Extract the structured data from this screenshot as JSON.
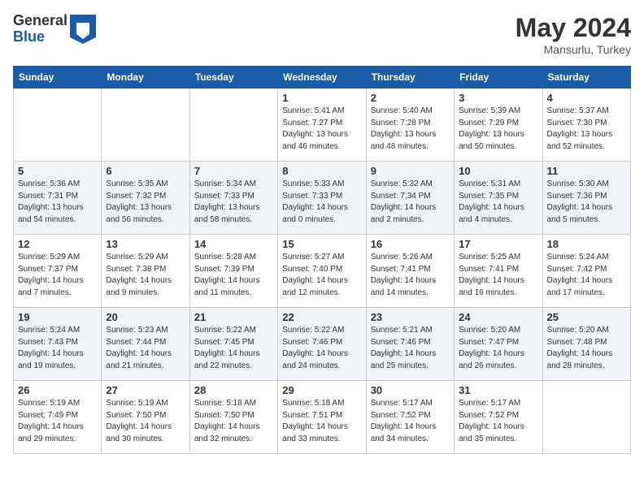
{
  "header": {
    "logo_line1": "General",
    "logo_line2": "Blue",
    "month_year": "May 2024",
    "location": "Mansurlu, Turkey"
  },
  "days_of_week": [
    "Sunday",
    "Monday",
    "Tuesday",
    "Wednesday",
    "Thursday",
    "Friday",
    "Saturday"
  ],
  "weeks": [
    [
      {
        "day": "",
        "info": ""
      },
      {
        "day": "",
        "info": ""
      },
      {
        "day": "",
        "info": ""
      },
      {
        "day": "1",
        "info": "Sunrise: 5:41 AM\nSunset: 7:27 PM\nDaylight: 13 hours\nand 46 minutes."
      },
      {
        "day": "2",
        "info": "Sunrise: 5:40 AM\nSunset: 7:28 PM\nDaylight: 13 hours\nand 48 minutes."
      },
      {
        "day": "3",
        "info": "Sunrise: 5:39 AM\nSunset: 7:29 PM\nDaylight: 13 hours\nand 50 minutes."
      },
      {
        "day": "4",
        "info": "Sunrise: 5:37 AM\nSunset: 7:30 PM\nDaylight: 13 hours\nand 52 minutes."
      }
    ],
    [
      {
        "day": "5",
        "info": "Sunrise: 5:36 AM\nSunset: 7:31 PM\nDaylight: 13 hours\nand 54 minutes."
      },
      {
        "day": "6",
        "info": "Sunrise: 5:35 AM\nSunset: 7:32 PM\nDaylight: 13 hours\nand 56 minutes."
      },
      {
        "day": "7",
        "info": "Sunrise: 5:34 AM\nSunset: 7:33 PM\nDaylight: 13 hours\nand 58 minutes."
      },
      {
        "day": "8",
        "info": "Sunrise: 5:33 AM\nSunset: 7:33 PM\nDaylight: 14 hours\nand 0 minutes."
      },
      {
        "day": "9",
        "info": "Sunrise: 5:32 AM\nSunset: 7:34 PM\nDaylight: 14 hours\nand 2 minutes."
      },
      {
        "day": "10",
        "info": "Sunrise: 5:31 AM\nSunset: 7:35 PM\nDaylight: 14 hours\nand 4 minutes."
      },
      {
        "day": "11",
        "info": "Sunrise: 5:30 AM\nSunset: 7:36 PM\nDaylight: 14 hours\nand 5 minutes."
      }
    ],
    [
      {
        "day": "12",
        "info": "Sunrise: 5:29 AM\nSunset: 7:37 PM\nDaylight: 14 hours\nand 7 minutes."
      },
      {
        "day": "13",
        "info": "Sunrise: 5:29 AM\nSunset: 7:38 PM\nDaylight: 14 hours\nand 9 minutes."
      },
      {
        "day": "14",
        "info": "Sunrise: 5:28 AM\nSunset: 7:39 PM\nDaylight: 14 hours\nand 11 minutes."
      },
      {
        "day": "15",
        "info": "Sunrise: 5:27 AM\nSunset: 7:40 PM\nDaylight: 14 hours\nand 12 minutes."
      },
      {
        "day": "16",
        "info": "Sunrise: 5:26 AM\nSunset: 7:41 PM\nDaylight: 14 hours\nand 14 minutes."
      },
      {
        "day": "17",
        "info": "Sunrise: 5:25 AM\nSunset: 7:41 PM\nDaylight: 14 hours\nand 16 minutes."
      },
      {
        "day": "18",
        "info": "Sunrise: 5:24 AM\nSunset: 7:42 PM\nDaylight: 14 hours\nand 17 minutes."
      }
    ],
    [
      {
        "day": "19",
        "info": "Sunrise: 5:24 AM\nSunset: 7:43 PM\nDaylight: 14 hours\nand 19 minutes."
      },
      {
        "day": "20",
        "info": "Sunrise: 5:23 AM\nSunset: 7:44 PM\nDaylight: 14 hours\nand 21 minutes."
      },
      {
        "day": "21",
        "info": "Sunrise: 5:22 AM\nSunset: 7:45 PM\nDaylight: 14 hours\nand 22 minutes."
      },
      {
        "day": "22",
        "info": "Sunrise: 5:22 AM\nSunset: 7:46 PM\nDaylight: 14 hours\nand 24 minutes."
      },
      {
        "day": "23",
        "info": "Sunrise: 5:21 AM\nSunset: 7:46 PM\nDaylight: 14 hours\nand 25 minutes."
      },
      {
        "day": "24",
        "info": "Sunrise: 5:20 AM\nSunset: 7:47 PM\nDaylight: 14 hours\nand 26 minutes."
      },
      {
        "day": "25",
        "info": "Sunrise: 5:20 AM\nSunset: 7:48 PM\nDaylight: 14 hours\nand 28 minutes."
      }
    ],
    [
      {
        "day": "26",
        "info": "Sunrise: 5:19 AM\nSunset: 7:49 PM\nDaylight: 14 hours\nand 29 minutes."
      },
      {
        "day": "27",
        "info": "Sunrise: 5:19 AM\nSunset: 7:50 PM\nDaylight: 14 hours\nand 30 minutes."
      },
      {
        "day": "28",
        "info": "Sunrise: 5:18 AM\nSunset: 7:50 PM\nDaylight: 14 hours\nand 32 minutes."
      },
      {
        "day": "29",
        "info": "Sunrise: 5:18 AM\nSunset: 7:51 PM\nDaylight: 14 hours\nand 33 minutes."
      },
      {
        "day": "30",
        "info": "Sunrise: 5:17 AM\nSunset: 7:52 PM\nDaylight: 14 hours\nand 34 minutes."
      },
      {
        "day": "31",
        "info": "Sunrise: 5:17 AM\nSunset: 7:52 PM\nDaylight: 14 hours\nand 35 minutes."
      },
      {
        "day": "",
        "info": ""
      }
    ]
  ]
}
